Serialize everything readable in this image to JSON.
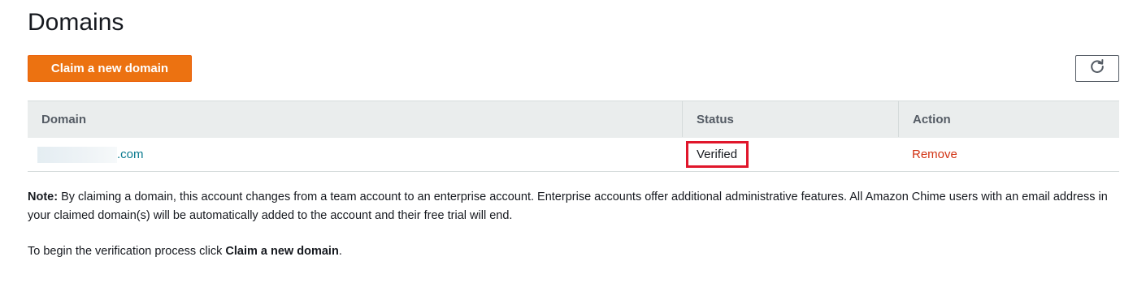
{
  "page": {
    "title": "Domains"
  },
  "toolbar": {
    "claim_label": "Claim a new domain",
    "refresh_icon": "refresh-icon"
  },
  "table": {
    "headers": {
      "domain": "Domain",
      "status": "Status",
      "action": "Action"
    },
    "rows": [
      {
        "domain_suffix": ".com",
        "status": "Verified",
        "action": "Remove"
      }
    ]
  },
  "note": {
    "label": "Note:",
    "text": " By claiming a domain, this account changes from a team account to an enterprise account. Enterprise accounts offer additional administrative features. All Amazon Chime users with an email address in your claimed domain(s) will be automatically added to the account and their free trial will end."
  },
  "instructions": {
    "prefix": "To begin the verification process click ",
    "emphasis": "Claim a new domain",
    "suffix": "."
  },
  "colors": {
    "primary_button": "#ec7211",
    "link": "#0073bb",
    "remove": "#d13212",
    "highlight": "#e0162b"
  }
}
